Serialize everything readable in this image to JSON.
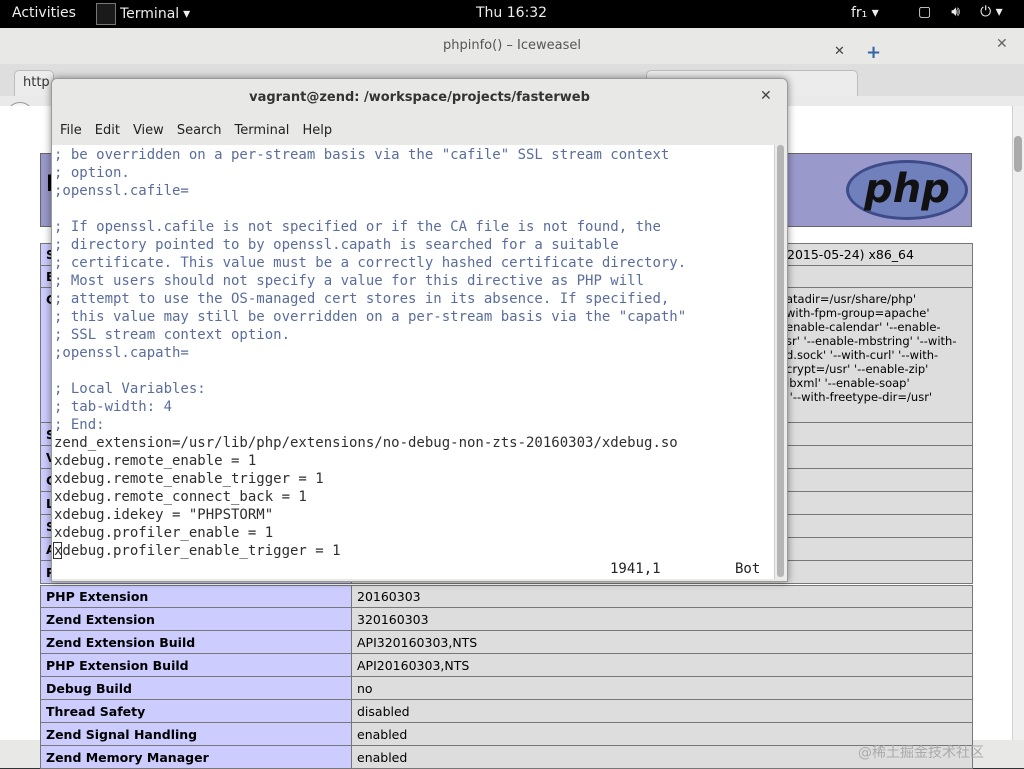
{
  "topbar": {
    "activities": "Activities",
    "app_name": "Terminal",
    "clock": "Thu 16:32",
    "lang": "fr₁"
  },
  "browser": {
    "title": "phpinfo() – Iceweasel",
    "tab_left": "http",
    "header_letter": "P",
    "logo_text": "php",
    "config_snippets": [
      "2015-05-24) x86_64",
      "atadir=/usr/share/php'\nwith-fpm-group=apache'\nenable-calendar' '--enable-\nsr' '--enable-mbstring' '--with-\nd.sock' '--with-curl' '--with-\ncrypt=/usr' '--enable-zip'\nibxml' '--enable-soap'\n '--with-freetype-dir=/usr'"
    ],
    "left_letters": [
      "S",
      "B",
      "C",
      "S",
      "V",
      "C",
      "L",
      "S",
      "A",
      "P"
    ],
    "rows": [
      {
        "key": "PHP Extension",
        "value": "20160303"
      },
      {
        "key": "Zend Extension",
        "value": "320160303"
      },
      {
        "key": "Zend Extension Build",
        "value": "API320160303,NTS"
      },
      {
        "key": "PHP Extension Build",
        "value": "API20160303,NTS"
      },
      {
        "key": "Debug Build",
        "value": "no"
      },
      {
        "key": "Thread Safety",
        "value": "disabled"
      },
      {
        "key": "Zend Signal Handling",
        "value": "enabled"
      },
      {
        "key": "Zend Memory Manager",
        "value": "enabled"
      }
    ]
  },
  "terminal": {
    "title": "vagrant@zend: /workspace/projects/fasterweb",
    "menu": [
      "File",
      "Edit",
      "View",
      "Search",
      "Terminal",
      "Help"
    ],
    "lines": [
      {
        "text": "; be overridden on a per-stream basis via the \"cafile\" SSL stream context",
        "kind": "comment"
      },
      {
        "text": "; option.",
        "kind": "comment"
      },
      {
        "text": ";openssl.cafile=",
        "kind": "comment"
      },
      {
        "text": "",
        "kind": "comment"
      },
      {
        "text": "; If openssl.cafile is not specified or if the CA file is not found, the",
        "kind": "comment"
      },
      {
        "text": "; directory pointed to by openssl.capath is searched for a suitable",
        "kind": "comment"
      },
      {
        "text": "; certificate. This value must be a correctly hashed certificate directory.",
        "kind": "comment"
      },
      {
        "text": "; Most users should not specify a value for this directive as PHP will",
        "kind": "comment"
      },
      {
        "text": "; attempt to use the OS-managed cert stores in its absence. If specified,",
        "kind": "comment"
      },
      {
        "text": "; this value may still be overridden on a per-stream basis via the \"capath\"",
        "kind": "comment"
      },
      {
        "text": "; SSL stream context option.",
        "kind": "comment"
      },
      {
        "text": ";openssl.capath=",
        "kind": "comment"
      },
      {
        "text": "",
        "kind": "comment"
      },
      {
        "text": "; Local Variables:",
        "kind": "comment"
      },
      {
        "text": "; tab-width: 4",
        "kind": "comment"
      },
      {
        "text": "; End:",
        "kind": "comment"
      },
      {
        "text": "zend_extension=/usr/lib/php/extensions/no-debug-non-zts-20160303/xdebug.so",
        "kind": "code"
      },
      {
        "text": "xdebug.remote_enable = 1",
        "kind": "code"
      },
      {
        "text": "xdebug.remote_enable_trigger = 1",
        "kind": "code"
      },
      {
        "text": "xdebug.remote_connect_back = 1",
        "kind": "code"
      },
      {
        "text": "xdebug.idekey = \"PHPSTORM\"",
        "kind": "code"
      },
      {
        "text": "xdebug.profiler_enable = 1",
        "kind": "code"
      },
      {
        "text": "xdebug.profiler_enable_trigger = 1",
        "kind": "code"
      }
    ],
    "status_position": "1941,1",
    "status_scroll": "Bot"
  },
  "watermark": "@稀土掘金技术社区",
  "colors": {
    "topbar": "#000000",
    "php_header": "#9999cc",
    "php_key_cell": "#ccccff",
    "php_value_cell": "#dddddd",
    "comment_text": "#5a6d9c"
  }
}
